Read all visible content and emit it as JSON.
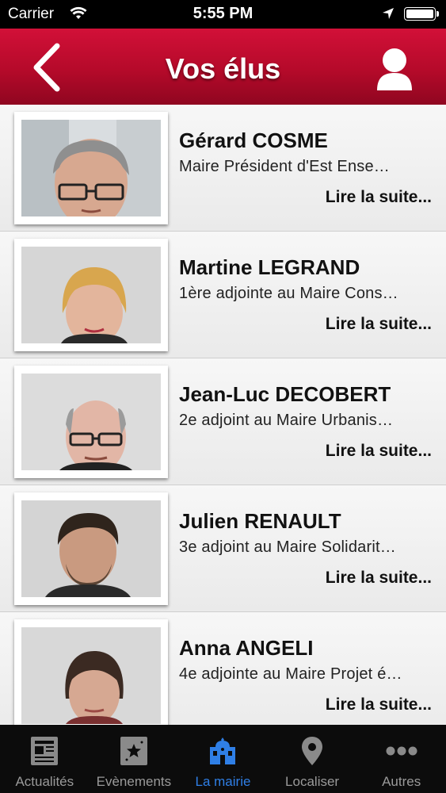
{
  "status_bar": {
    "carrier": "Carrier",
    "time": "5:55 PM"
  },
  "nav": {
    "title": "Vos élus",
    "back_icon": "chevron-left-icon",
    "profile_icon": "user-icon"
  },
  "elected": [
    {
      "name": "Gérard COSME",
      "role": "Maire Président d'Est Ense…",
      "more": "Lire la suite..."
    },
    {
      "name": "Martine LEGRAND",
      "role": "1ère adjointe au Maire Cons…",
      "more": "Lire la suite..."
    },
    {
      "name": "Jean-Luc DECOBERT",
      "role": "2e adjoint au Maire Urbanis…",
      "more": "Lire la suite..."
    },
    {
      "name": "Julien RENAULT",
      "role": "3e adjoint au Maire Solidarit…",
      "more": "Lire la suite..."
    },
    {
      "name": "Anna ANGELI",
      "role": "4e adjointe au Maire Projet é…",
      "more": "Lire la suite..."
    }
  ],
  "tabs": [
    {
      "label": "Actualités",
      "icon": "newspaper-icon",
      "active": false
    },
    {
      "label": "Evènements",
      "icon": "star-calendar-icon",
      "active": false
    },
    {
      "label": "La mairie",
      "icon": "town-hall-icon",
      "active": true
    },
    {
      "label": "Localiser",
      "icon": "map-pin-icon",
      "active": false
    },
    {
      "label": "Autres",
      "icon": "more-dots-icon",
      "active": false
    }
  ],
  "colors": {
    "nav_red": "#c00d30",
    "tab_active": "#2f7fe6",
    "tab_inactive": "#9a9a9a"
  }
}
